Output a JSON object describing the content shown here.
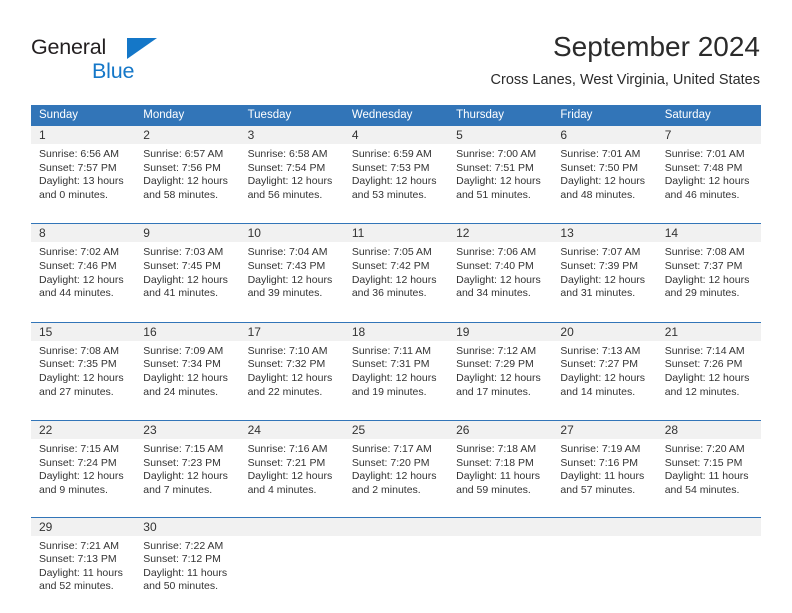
{
  "brand": {
    "name_top": "General",
    "name_bottom": "Blue",
    "logo_icon": "triangle-logo-icon",
    "accent_color": "#1477c8"
  },
  "header": {
    "title": "September 2024",
    "subtitle": "Cross Lanes, West Virginia, United States"
  },
  "colors": {
    "header_blue": "#3275b8",
    "daynum_background": "#f1f1f1",
    "text": "#333333"
  },
  "calendar": {
    "weekday_headers": [
      "Sunday",
      "Monday",
      "Tuesday",
      "Wednesday",
      "Thursday",
      "Friday",
      "Saturday"
    ],
    "weeks": [
      [
        {
          "day": "1",
          "sunrise": "Sunrise: 6:56 AM",
          "sunset": "Sunset: 7:57 PM",
          "daylight_1": "Daylight: 13 hours",
          "daylight_2": "and 0 minutes."
        },
        {
          "day": "2",
          "sunrise": "Sunrise: 6:57 AM",
          "sunset": "Sunset: 7:56 PM",
          "daylight_1": "Daylight: 12 hours",
          "daylight_2": "and 58 minutes."
        },
        {
          "day": "3",
          "sunrise": "Sunrise: 6:58 AM",
          "sunset": "Sunset: 7:54 PM",
          "daylight_1": "Daylight: 12 hours",
          "daylight_2": "and 56 minutes."
        },
        {
          "day": "4",
          "sunrise": "Sunrise: 6:59 AM",
          "sunset": "Sunset: 7:53 PM",
          "daylight_1": "Daylight: 12 hours",
          "daylight_2": "and 53 minutes."
        },
        {
          "day": "5",
          "sunrise": "Sunrise: 7:00 AM",
          "sunset": "Sunset: 7:51 PM",
          "daylight_1": "Daylight: 12 hours",
          "daylight_2": "and 51 minutes."
        },
        {
          "day": "6",
          "sunrise": "Sunrise: 7:01 AM",
          "sunset": "Sunset: 7:50 PM",
          "daylight_1": "Daylight: 12 hours",
          "daylight_2": "and 48 minutes."
        },
        {
          "day": "7",
          "sunrise": "Sunrise: 7:01 AM",
          "sunset": "Sunset: 7:48 PM",
          "daylight_1": "Daylight: 12 hours",
          "daylight_2": "and 46 minutes."
        }
      ],
      [
        {
          "day": "8",
          "sunrise": "Sunrise: 7:02 AM",
          "sunset": "Sunset: 7:46 PM",
          "daylight_1": "Daylight: 12 hours",
          "daylight_2": "and 44 minutes."
        },
        {
          "day": "9",
          "sunrise": "Sunrise: 7:03 AM",
          "sunset": "Sunset: 7:45 PM",
          "daylight_1": "Daylight: 12 hours",
          "daylight_2": "and 41 minutes."
        },
        {
          "day": "10",
          "sunrise": "Sunrise: 7:04 AM",
          "sunset": "Sunset: 7:43 PM",
          "daylight_1": "Daylight: 12 hours",
          "daylight_2": "and 39 minutes."
        },
        {
          "day": "11",
          "sunrise": "Sunrise: 7:05 AM",
          "sunset": "Sunset: 7:42 PM",
          "daylight_1": "Daylight: 12 hours",
          "daylight_2": "and 36 minutes."
        },
        {
          "day": "12",
          "sunrise": "Sunrise: 7:06 AM",
          "sunset": "Sunset: 7:40 PM",
          "daylight_1": "Daylight: 12 hours",
          "daylight_2": "and 34 minutes."
        },
        {
          "day": "13",
          "sunrise": "Sunrise: 7:07 AM",
          "sunset": "Sunset: 7:39 PM",
          "daylight_1": "Daylight: 12 hours",
          "daylight_2": "and 31 minutes."
        },
        {
          "day": "14",
          "sunrise": "Sunrise: 7:08 AM",
          "sunset": "Sunset: 7:37 PM",
          "daylight_1": "Daylight: 12 hours",
          "daylight_2": "and 29 minutes."
        }
      ],
      [
        {
          "day": "15",
          "sunrise": "Sunrise: 7:08 AM",
          "sunset": "Sunset: 7:35 PM",
          "daylight_1": "Daylight: 12 hours",
          "daylight_2": "and 27 minutes."
        },
        {
          "day": "16",
          "sunrise": "Sunrise: 7:09 AM",
          "sunset": "Sunset: 7:34 PM",
          "daylight_1": "Daylight: 12 hours",
          "daylight_2": "and 24 minutes."
        },
        {
          "day": "17",
          "sunrise": "Sunrise: 7:10 AM",
          "sunset": "Sunset: 7:32 PM",
          "daylight_1": "Daylight: 12 hours",
          "daylight_2": "and 22 minutes."
        },
        {
          "day": "18",
          "sunrise": "Sunrise: 7:11 AM",
          "sunset": "Sunset: 7:31 PM",
          "daylight_1": "Daylight: 12 hours",
          "daylight_2": "and 19 minutes."
        },
        {
          "day": "19",
          "sunrise": "Sunrise: 7:12 AM",
          "sunset": "Sunset: 7:29 PM",
          "daylight_1": "Daylight: 12 hours",
          "daylight_2": "and 17 minutes."
        },
        {
          "day": "20",
          "sunrise": "Sunrise: 7:13 AM",
          "sunset": "Sunset: 7:27 PM",
          "daylight_1": "Daylight: 12 hours",
          "daylight_2": "and 14 minutes."
        },
        {
          "day": "21",
          "sunrise": "Sunrise: 7:14 AM",
          "sunset": "Sunset: 7:26 PM",
          "daylight_1": "Daylight: 12 hours",
          "daylight_2": "and 12 minutes."
        }
      ],
      [
        {
          "day": "22",
          "sunrise": "Sunrise: 7:15 AM",
          "sunset": "Sunset: 7:24 PM",
          "daylight_1": "Daylight: 12 hours",
          "daylight_2": "and 9 minutes."
        },
        {
          "day": "23",
          "sunrise": "Sunrise: 7:15 AM",
          "sunset": "Sunset: 7:23 PM",
          "daylight_1": "Daylight: 12 hours",
          "daylight_2": "and 7 minutes."
        },
        {
          "day": "24",
          "sunrise": "Sunrise: 7:16 AM",
          "sunset": "Sunset: 7:21 PM",
          "daylight_1": "Daylight: 12 hours",
          "daylight_2": "and 4 minutes."
        },
        {
          "day": "25",
          "sunrise": "Sunrise: 7:17 AM",
          "sunset": "Sunset: 7:20 PM",
          "daylight_1": "Daylight: 12 hours",
          "daylight_2": "and 2 minutes."
        },
        {
          "day": "26",
          "sunrise": "Sunrise: 7:18 AM",
          "sunset": "Sunset: 7:18 PM",
          "daylight_1": "Daylight: 11 hours",
          "daylight_2": "and 59 minutes."
        },
        {
          "day": "27",
          "sunrise": "Sunrise: 7:19 AM",
          "sunset": "Sunset: 7:16 PM",
          "daylight_1": "Daylight: 11 hours",
          "daylight_2": "and 57 minutes."
        },
        {
          "day": "28",
          "sunrise": "Sunrise: 7:20 AM",
          "sunset": "Sunset: 7:15 PM",
          "daylight_1": "Daylight: 11 hours",
          "daylight_2": "and 54 minutes."
        }
      ],
      [
        {
          "day": "29",
          "sunrise": "Sunrise: 7:21 AM",
          "sunset": "Sunset: 7:13 PM",
          "daylight_1": "Daylight: 11 hours",
          "daylight_2": "and 52 minutes."
        },
        {
          "day": "30",
          "sunrise": "Sunrise: 7:22 AM",
          "sunset": "Sunset: 7:12 PM",
          "daylight_1": "Daylight: 11 hours",
          "daylight_2": "and 50 minutes."
        },
        {
          "day": "",
          "sunrise": "",
          "sunset": "",
          "daylight_1": "",
          "daylight_2": ""
        },
        {
          "day": "",
          "sunrise": "",
          "sunset": "",
          "daylight_1": "",
          "daylight_2": ""
        },
        {
          "day": "",
          "sunrise": "",
          "sunset": "",
          "daylight_1": "",
          "daylight_2": ""
        },
        {
          "day": "",
          "sunrise": "",
          "sunset": "",
          "daylight_1": "",
          "daylight_2": ""
        },
        {
          "day": "",
          "sunrise": "",
          "sunset": "",
          "daylight_1": "",
          "daylight_2": ""
        }
      ]
    ]
  }
}
